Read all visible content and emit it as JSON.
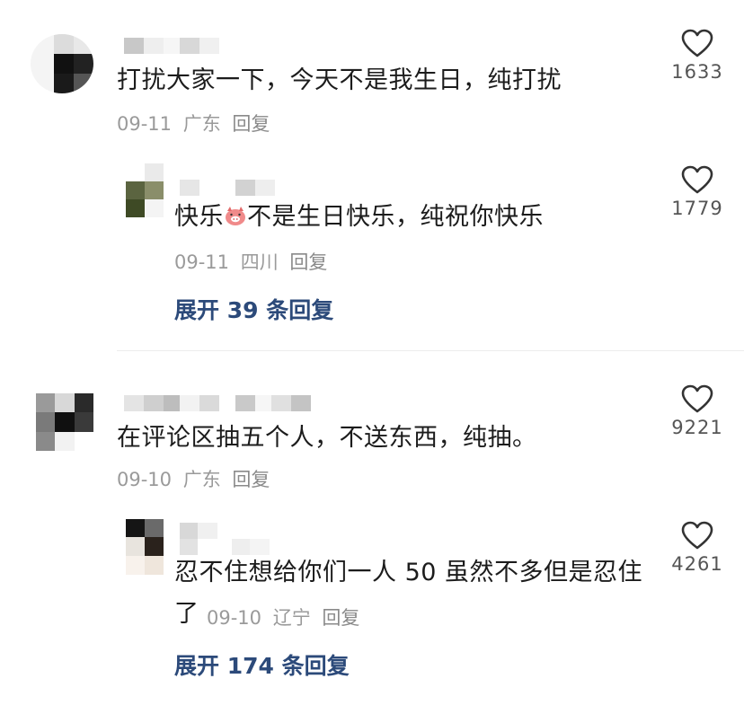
{
  "comments": [
    {
      "text": "打扰大家一下，今天不是我生日，纯打扰",
      "date": "09-11",
      "location": "广东",
      "reply_label": "回复",
      "likes": "1633",
      "replies": [
        {
          "text_before_emoji": "快乐",
          "emoji": "pig-emoji",
          "text_after_emoji": "不是生日快乐，纯祝你快乐",
          "date": "09-11",
          "location": "四川",
          "reply_label": "回复",
          "likes": "1779"
        }
      ],
      "expand_label": "展开 39 条回复"
    },
    {
      "text": "在评论区抽五个人，不送东西，纯抽。",
      "date": "09-10",
      "location": "广东",
      "reply_label": "回复",
      "likes": "9221",
      "replies": [
        {
          "text_line1": "忍不住想给你们一人 50 虽然不多但是忍住",
          "text_line2": "了",
          "date": "09-10",
          "location": "辽宁",
          "reply_label": "回复",
          "likes": "4261"
        }
      ],
      "expand_label": "展开 174 条回复"
    }
  ],
  "icons": {
    "like": "heart-outline-icon"
  },
  "colors": {
    "link": "#2c4a7a",
    "meta": "#9a9a9a"
  }
}
